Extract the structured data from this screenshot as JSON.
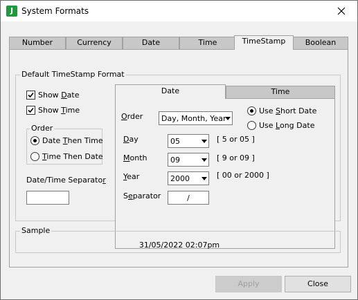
{
  "window": {
    "title": "System Formats",
    "icon_letter": "J"
  },
  "tabs": [
    "Number",
    "Currency",
    "Date",
    "Time",
    "TimeStamp",
    "Boolean"
  ],
  "active_tab": "TimeStamp",
  "default_group": {
    "label": "Default TimeStamp Format"
  },
  "show_date": {
    "prefix": "Show ",
    "accel": "D",
    "rest": "ate",
    "checked": true
  },
  "show_time": {
    "prefix": "Show ",
    "accel": "T",
    "rest": "ime",
    "checked": true
  },
  "order_group": {
    "label": "Order",
    "date_then_time": {
      "prefix": "Date ",
      "accel": "T",
      "rest": "hen Time",
      "selected": true
    },
    "time_then_date": {
      "prefix": "",
      "accel": "T",
      "rest": "ime Then Date",
      "selected": false
    }
  },
  "separator_field": {
    "prefix": "Date/Time Separato",
    "accel": "r",
    "rest": "",
    "value": ""
  },
  "inner_tabs": {
    "date": "Date",
    "time": "Time"
  },
  "date_panel": {
    "order": {
      "accel": "O",
      "rest": "rder",
      "value": "Day, Month, Year"
    },
    "use_short_date": {
      "prefix": "Use ",
      "accel": "S",
      "rest": "hort Date",
      "selected": true
    },
    "use_long_date": {
      "prefix": "Use ",
      "accel": "L",
      "rest": "ong Date",
      "selected": false
    },
    "day": {
      "accel": "D",
      "rest": "ay",
      "value": "05",
      "hint": "[ 5 or 05 ]"
    },
    "month": {
      "accel": "M",
      "rest": "onth",
      "value": "09",
      "hint": "[ 9 or 09 ]"
    },
    "year": {
      "accel": "Y",
      "rest": "ear",
      "value": "2000",
      "hint": "[ 00 or 2000 ]"
    },
    "separator": {
      "prefix": "S",
      "accel": "e",
      "rest": "parator",
      "value": "/"
    }
  },
  "sample": {
    "label": "Sample",
    "value": "31/05/2022 02:07pm"
  },
  "buttons": {
    "apply": "Apply",
    "close": "Close"
  }
}
